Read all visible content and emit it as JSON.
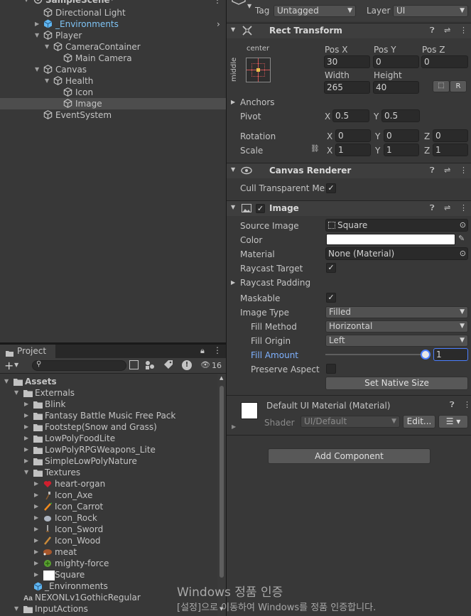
{
  "hierarchy": {
    "scene": "SampleScene*",
    "items": [
      {
        "label": "Directional Light",
        "depth": 1,
        "arrow": "",
        "icon": "cube-icon",
        "prefab": false,
        "selected": false
      },
      {
        "label": "_Environments",
        "depth": 1,
        "arrow": "▶",
        "icon": "prefab-icon",
        "prefab": true,
        "selected": false
      },
      {
        "label": "Player",
        "depth": 1,
        "arrow": "▼",
        "icon": "cube-icon",
        "prefab": false,
        "selected": false
      },
      {
        "label": "CameraContainer",
        "depth": 2,
        "arrow": "▼",
        "icon": "cube-icon",
        "prefab": false,
        "selected": false
      },
      {
        "label": "Main Camera",
        "depth": 3,
        "arrow": "",
        "icon": "cube-icon",
        "prefab": false,
        "selected": false
      },
      {
        "label": "Canvas",
        "depth": 1,
        "arrow": "▼",
        "icon": "cube-icon",
        "prefab": false,
        "selected": false
      },
      {
        "label": "Health",
        "depth": 2,
        "arrow": "▼",
        "icon": "cube-icon",
        "prefab": false,
        "selected": false
      },
      {
        "label": "Icon",
        "depth": 3,
        "arrow": "",
        "icon": "cube-icon",
        "prefab": false,
        "selected": false
      },
      {
        "label": "Image",
        "depth": 3,
        "arrow": "",
        "icon": "cube-icon",
        "prefab": false,
        "selected": true
      },
      {
        "label": "EventSystem",
        "depth": 1,
        "arrow": "",
        "icon": "cube-icon",
        "prefab": false,
        "selected": false
      }
    ]
  },
  "project": {
    "tab": "Project",
    "hidden_count": "16",
    "items": [
      {
        "label": "Assets",
        "depth": 0,
        "arrow": "▼",
        "icon": "folder-icon",
        "bold": true
      },
      {
        "label": "Externals",
        "depth": 1,
        "arrow": "▼",
        "icon": "folder-icon"
      },
      {
        "label": "Blink",
        "depth": 2,
        "arrow": "▶",
        "icon": "folder-icon"
      },
      {
        "label": "Fantasy Battle Music Free Pack",
        "depth": 2,
        "arrow": "▶",
        "icon": "folder-icon"
      },
      {
        "label": "Footstep(Snow and Grass)",
        "depth": 2,
        "arrow": "▶",
        "icon": "folder-icon"
      },
      {
        "label": "LowPolyFoodLite",
        "depth": 2,
        "arrow": "▶",
        "icon": "folder-icon"
      },
      {
        "label": "LowPolyRPGWeapons_Lite",
        "depth": 2,
        "arrow": "▶",
        "icon": "folder-icon"
      },
      {
        "label": "SimpleLowPolyNature",
        "depth": 2,
        "arrow": "▶",
        "icon": "folder-icon"
      },
      {
        "label": "Textures",
        "depth": 2,
        "arrow": "▼",
        "icon": "folder-icon"
      },
      {
        "label": "heart-organ",
        "depth": 3,
        "arrow": "▶",
        "icon": "heart-texture-icon"
      },
      {
        "label": "Icon_Axe",
        "depth": 3,
        "arrow": "▶",
        "icon": "axe-texture-icon"
      },
      {
        "label": "Icon_Carrot",
        "depth": 3,
        "arrow": "▶",
        "icon": "carrot-texture-icon"
      },
      {
        "label": "Icon_Rock",
        "depth": 3,
        "arrow": "▶",
        "icon": "rock-texture-icon"
      },
      {
        "label": "Icon_Sword",
        "depth": 3,
        "arrow": "▶",
        "icon": "sword-texture-icon"
      },
      {
        "label": "Icon_Wood",
        "depth": 3,
        "arrow": "▶",
        "icon": "wood-texture-icon"
      },
      {
        "label": "meat",
        "depth": 3,
        "arrow": "▶",
        "icon": "meat-texture-icon"
      },
      {
        "label": "mighty-force",
        "depth": 3,
        "arrow": "▶",
        "icon": "force-texture-icon"
      },
      {
        "label": "Square",
        "depth": 3,
        "arrow": "▶",
        "icon": "square-texture-icon"
      },
      {
        "label": "_Environments",
        "depth": 2,
        "arrow": "",
        "icon": "prefab-icon"
      },
      {
        "label": "NEXONLv1GothicRegular",
        "depth": 1,
        "arrow": "",
        "icon": "font-icon"
      },
      {
        "label": "InputActions",
        "depth": 1,
        "arrow": "▼",
        "icon": "folder-icon"
      }
    ]
  },
  "inspector": {
    "tag_label": "Tag",
    "tag_value": "Untagged",
    "layer_label": "Layer",
    "layer_value": "UI",
    "rect_transform": {
      "title": "Rect Transform",
      "anchor_h": "center",
      "anchor_v": "middle",
      "posx_label": "Pos X",
      "posy_label": "Pos Y",
      "posz_label": "Pos Z",
      "posx": "30",
      "posy": "0",
      "posz": "0",
      "width_label": "Width",
      "height_label": "Height",
      "width": "265",
      "height": "40",
      "r_button": "R",
      "anchors_label": "Anchors",
      "pivot_label": "Pivot",
      "pivot_x": "0.5",
      "pivot_y": "0.5",
      "rotation_label": "Rotation",
      "rot_x": "0",
      "rot_y": "0",
      "rot_z": "0",
      "scale_label": "Scale",
      "scale_x": "1",
      "scale_y": "1",
      "scale_z": "1",
      "x": "X",
      "y": "Y",
      "z": "Z"
    },
    "canvas_renderer": {
      "title": "Canvas Renderer",
      "cull_label": "Cull Transparent Mes",
      "cull_checked": true
    },
    "image": {
      "title": "Image",
      "source_image_label": "Source Image",
      "source_image": "Square",
      "color_label": "Color",
      "color": "#ffffff",
      "material_label": "Material",
      "material": "None (Material)",
      "raycast_target_label": "Raycast Target",
      "raycast_padding_label": "Raycast Padding",
      "maskable_label": "Maskable",
      "image_type_label": "Image Type",
      "image_type": "Filled",
      "fill_method_label": "Fill Method",
      "fill_method": "Horizontal",
      "fill_origin_label": "Fill Origin",
      "fill_origin": "Left",
      "fill_amount_label": "Fill Amount",
      "fill_amount": "1",
      "preserve_aspect_label": "Preserve Aspect",
      "set_native_size": "Set Native Size"
    },
    "material_section": {
      "title": "Default UI Material (Material)",
      "shader_label": "Shader",
      "shader": "UI/Default",
      "edit_button": "Edit..."
    },
    "add_component": "Add Component"
  },
  "watermark": {
    "line1": "Windows 정품 인증",
    "line2": "[설정]으로 이동하여 Windows를 정품 인증합니다."
  },
  "colors": {
    "accent": "#4c7fff",
    "selected_link": "#7fb2ff",
    "prefab": "#5fb6f2"
  }
}
